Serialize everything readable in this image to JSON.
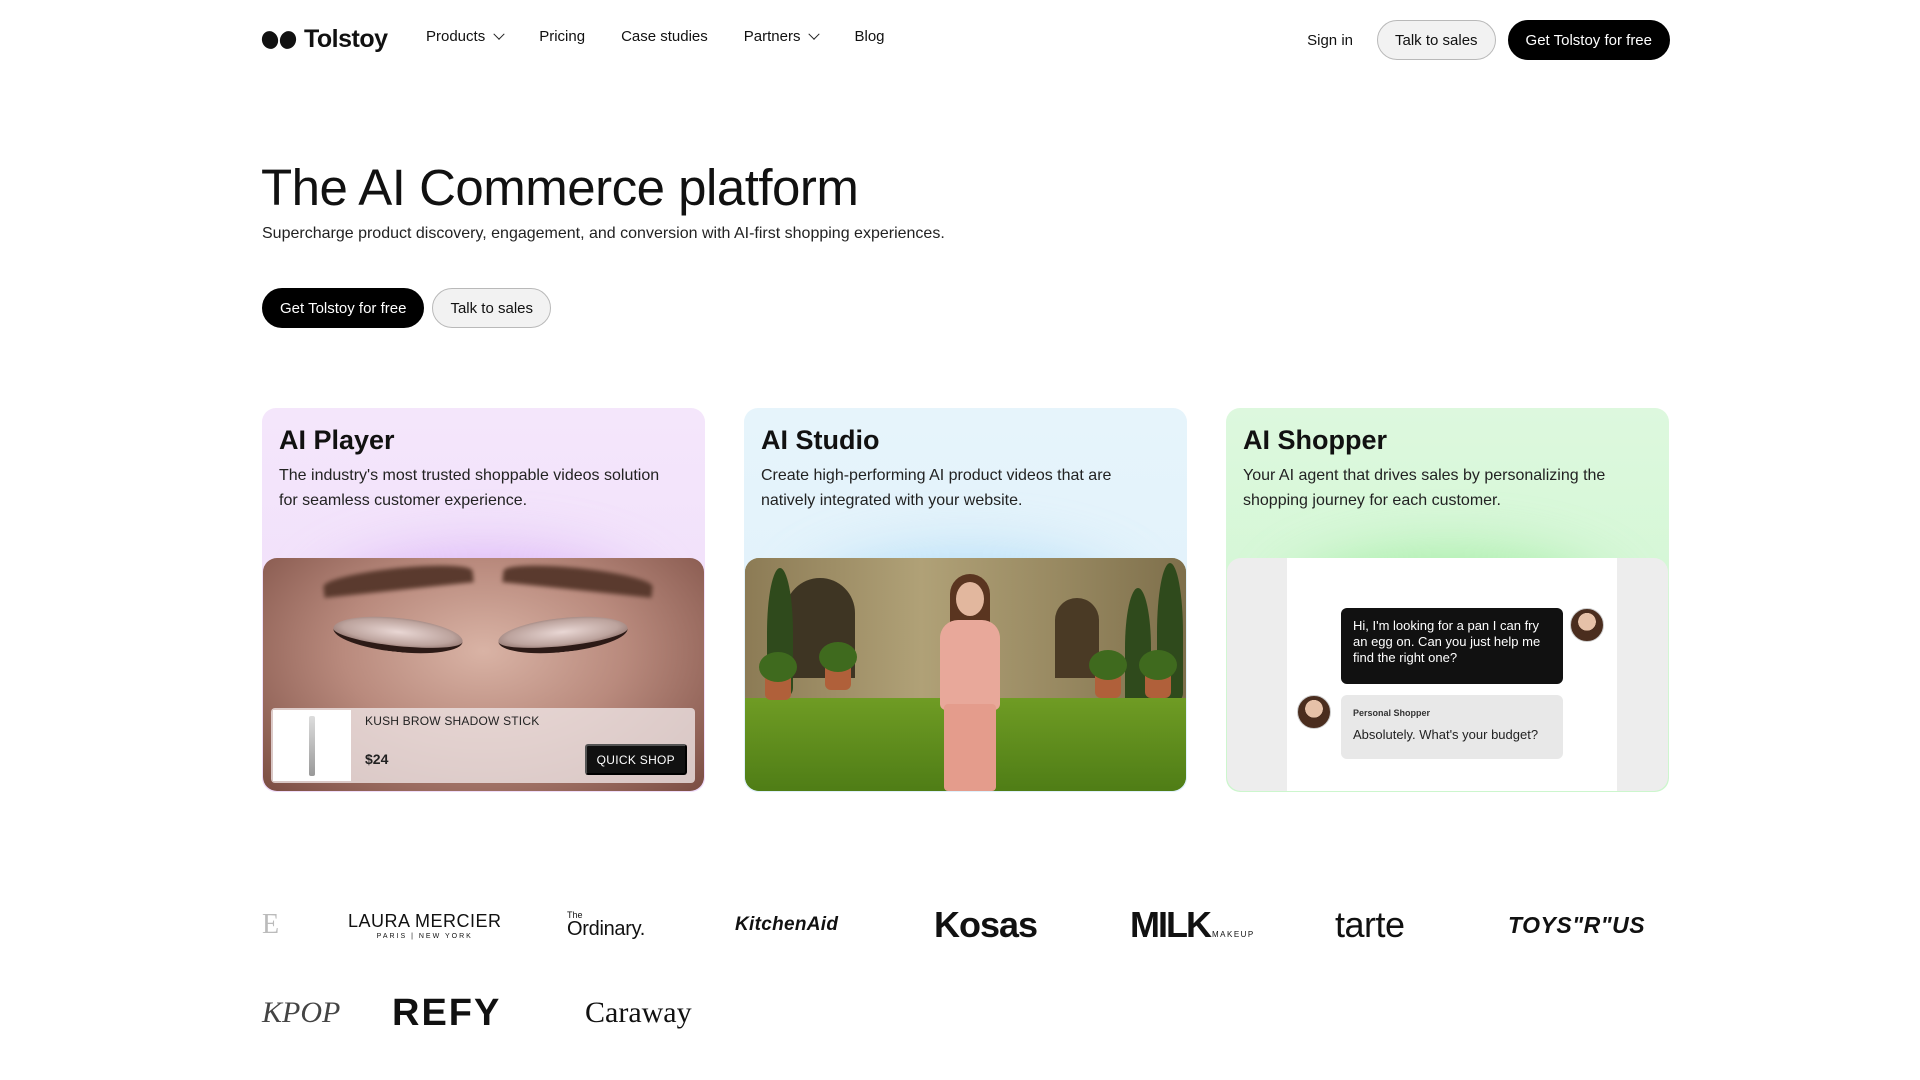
{
  "nav": {
    "logo_text": "Tolstoy",
    "links": [
      {
        "label": "Products",
        "has_dropdown": true
      },
      {
        "label": "Pricing",
        "has_dropdown": false
      },
      {
        "label": "Case studies",
        "has_dropdown": false
      },
      {
        "label": "Partners",
        "has_dropdown": true
      },
      {
        "label": "Blog",
        "has_dropdown": false
      }
    ],
    "sign_in": "Sign in",
    "talk_to_sales": "Talk to sales",
    "get_free": "Get Tolstoy for free"
  },
  "hero": {
    "title": "The AI Commerce platform",
    "subtitle": "Supercharge product discovery, engagement, and conversion with AI-first shopping experiences.",
    "primary_cta": "Get Tolstoy for free",
    "secondary_cta": "Talk to sales"
  },
  "cards": [
    {
      "title": "AI Player",
      "description": "The industry's most trusted shoppable videos solution for seamless customer experience.",
      "product": {
        "name": "KUSH BROW SHADOW STICK",
        "price": "$24",
        "cta": "QUICK SHOP"
      }
    },
    {
      "title": "AI Studio",
      "description": "Create high-performing AI product videos that are natively integrated with your website."
    },
    {
      "title": "AI Shopper",
      "description": "Your AI agent that drives sales by personalizing the shopping journey for each customer.",
      "chat": {
        "user_message": "Hi, I'm looking for a pan I can fry an egg on. Can you just help me find the right one?",
        "bot_label": "Personal Shopper",
        "bot_message": "Absolutely. What's your budget?"
      }
    }
  ],
  "brands": {
    "row1": {
      "e": "E",
      "laura_main": "LAURA MERCIER",
      "laura_sub": "PARIS | NEW YORK",
      "ordinary_pre": "The",
      "ordinary_main": "Ordinary.",
      "kitchenaid": "KitchenAid",
      "kosas": "Kosas",
      "milk_main": "MILK",
      "milk_sub": "MAKEUP",
      "tarte": "tarte",
      "toys": "TOYS\"R\"US"
    },
    "row2": {
      "pop": "KPOP",
      "refy": "REFY",
      "caraway": "Caraway"
    }
  },
  "colors": {
    "primary_button": "#000000",
    "card_player_bg": "#f4e6fb",
    "card_studio_bg": "#e6f4fb",
    "card_shopper_bg": "#ddf8de"
  }
}
